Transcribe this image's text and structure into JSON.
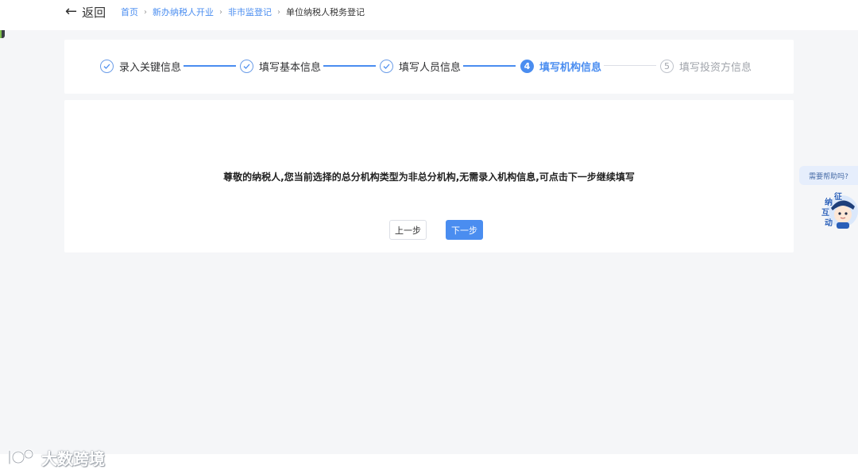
{
  "header": {
    "back_label": "返回",
    "breadcrumb": {
      "home": "首页",
      "level2": "新办纳税人开业",
      "level3": "非市监登记",
      "current": "单位纳税人税务登记",
      "separator": "›"
    }
  },
  "steps": [
    {
      "number": "1",
      "label": "录入关键信息",
      "state": "done"
    },
    {
      "number": "2",
      "label": "填写基本信息",
      "state": "done"
    },
    {
      "number": "3",
      "label": "填写人员信息",
      "state": "done"
    },
    {
      "number": "4",
      "label": "填写机构信息",
      "state": "active"
    },
    {
      "number": "5",
      "label": "填写投资方信息",
      "state": "pending"
    }
  ],
  "main": {
    "notice": "尊敬的纳税人,您当前选择的总分机构类型为非总分机构,无需录入机构信息,可点击下一步继续填写",
    "prev_label": "上一步",
    "next_label": "下一步"
  },
  "help": {
    "bubble": "需要帮助吗?",
    "assistant_chars": [
      "征",
      "纳",
      "互",
      "动"
    ]
  },
  "watermark": {
    "text": "大数跨境"
  },
  "colors": {
    "accent": "#4a8df0",
    "pending": "#a0a4ab",
    "background": "#f5f6f8"
  }
}
